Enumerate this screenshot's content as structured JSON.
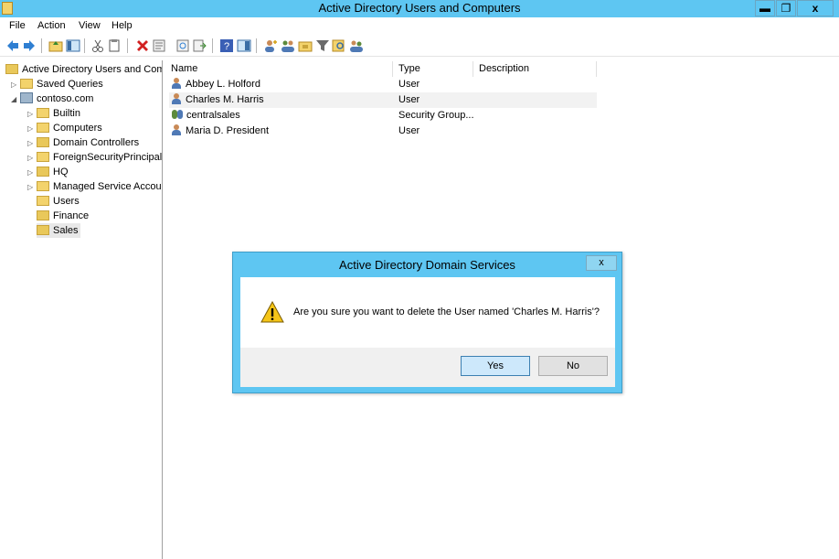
{
  "window": {
    "title": "Active Directory Users and Computers",
    "min_glyph": "▬",
    "max_glyph": "❐",
    "close_glyph": "x"
  },
  "menu": [
    "File",
    "Action",
    "View",
    "Help"
  ],
  "toolbar_icons": [
    "back-arrow-icon",
    "forward-arrow-icon",
    "up-folder-icon",
    "show-hide-tree-icon",
    "cut-icon",
    "copy-icon",
    "delete-icon",
    "properties-icon",
    "refresh-icon",
    "export-list-icon",
    "help-icon",
    "console-tree-icon",
    "create-user-icon",
    "create-group-icon",
    "create-ou-icon",
    "filter-icon",
    "find-icon",
    "add-to-group-icon"
  ],
  "tree": {
    "root": "Active Directory Users and Com",
    "saved_queries": "Saved Queries",
    "domain": "contoso.com",
    "children": [
      "Builtin",
      "Computers",
      "Domain Controllers",
      "ForeignSecurityPrincipals",
      "HQ",
      "Managed Service Accour",
      "Users",
      "Finance",
      "Sales"
    ],
    "selected": "Sales"
  },
  "list": {
    "columns": [
      "Name",
      "Type",
      "Description"
    ],
    "rows": [
      {
        "name": "Abbey L. Holford",
        "type": "User",
        "icon": "user-icon"
      },
      {
        "name": "Charles M. Harris",
        "type": "User",
        "icon": "user-icon"
      },
      {
        "name": "centralsales",
        "type": "Security Group...",
        "icon": "group-icon"
      },
      {
        "name": "Maria D. President",
        "type": "User",
        "icon": "user-icon"
      }
    ]
  },
  "dialog": {
    "title": "Active Directory Domain Services",
    "message": "Are you sure you want to delete the User named 'Charles M. Harris'?",
    "yes": "Yes",
    "no": "No",
    "close": "x"
  }
}
